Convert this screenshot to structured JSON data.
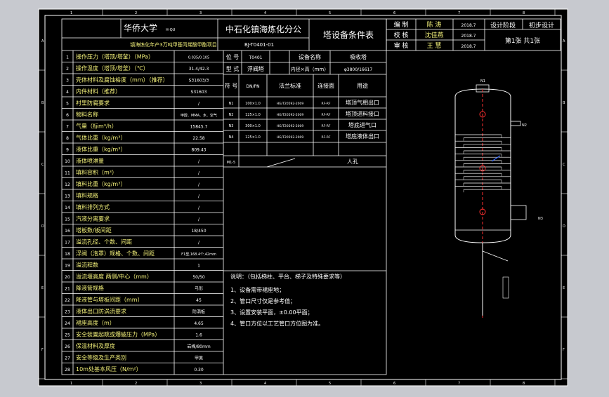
{
  "colors": {
    "background": "#c7c9cf",
    "sheet": "#000000",
    "line": "#ffffff",
    "text": "#ffffff",
    "highlight": "#f2f07a",
    "column_stroke": "#ffffff",
    "accent": "#ff3030",
    "marker": "#3a6cff",
    "arrow": "#00c8ff"
  },
  "header": {
    "university": "华侨大学",
    "university_suffix": "H-QU",
    "company": "中石化镇海炼化分公",
    "project": "镇海炼化年产3万吨甲基丙烯酸甲酯项目",
    "drawing_no": "BJ-T0401-01",
    "table_title": "塔设备条件表",
    "roles": [
      {
        "role": "编 制",
        "name": "陈 涛",
        "date": "2018.7"
      },
      {
        "role": "校 核",
        "name": "沈佳燕",
        "date": "2018.7"
      },
      {
        "role": "审 核",
        "name": "王 慧",
        "date": "2018.7"
      }
    ],
    "stage_label": "设计阶段",
    "stage_value": "初步设计",
    "sheet_info": "第1张 共1张"
  },
  "frame": {
    "left_letters": [
      "A",
      "B",
      "C",
      "D",
      "E",
      "F"
    ],
    "right_letters": [
      "A",
      "B",
      "C",
      "D",
      "E",
      "F"
    ],
    "top_numbers": [
      "1",
      "2",
      "3",
      "4",
      "5",
      "6",
      "7",
      "8"
    ],
    "bottom_numbers": [
      "1",
      "2",
      "3",
      "4",
      "5",
      "6",
      "7",
      "8"
    ]
  },
  "rows": [
    {
      "no": "1",
      "label": "操作压力（塔顶/塔釜）（MPa）",
      "value": "0.035/0.105"
    },
    {
      "no": "2",
      "label": "操作温度（塔顶/塔釜）（℃）",
      "value": "31.4/42.3"
    },
    {
      "no": "3",
      "label": "壳体材料及腐蚀裕度（mm）（推荐）",
      "value": "S31603/3"
    },
    {
      "no": "4",
      "label": "内件材料（推荐）",
      "value": "S31603"
    },
    {
      "no": "5",
      "label": "衬里防腐要求",
      "value": "/"
    },
    {
      "no": "6",
      "label": "物料名称",
      "value": "甲醇、MMA、水、空气"
    },
    {
      "no": "7",
      "label": "气量（标m³/h）",
      "value": "15845.7"
    },
    {
      "no": "8",
      "label": "气体比重（kg/m³）",
      "value": "22.58"
    },
    {
      "no": "9",
      "label": "液体比重（kg/m³）",
      "value": "809.43"
    },
    {
      "no": "10",
      "label": "液体喷淋量",
      "value": "/"
    },
    {
      "no": "11",
      "label": "填料容积（m³）",
      "value": "/"
    },
    {
      "no": "12",
      "label": "填料比重（kg/m³）",
      "value": "/"
    },
    {
      "no": "13",
      "label": "填料规格",
      "value": "/"
    },
    {
      "no": "14",
      "label": "填料排列方式",
      "value": "/"
    },
    {
      "no": "15",
      "label": "汽液分离要求",
      "value": "/"
    },
    {
      "no": "16",
      "label": "塔板数/板间距",
      "value": "18/450"
    },
    {
      "no": "17",
      "label": "溢流孔径、个数、间距",
      "value": "/"
    },
    {
      "no": "18",
      "label": "浮阀（泡罩）规格、个数、间距",
      "value": "F1型,168.4个,42mm"
    },
    {
      "no": "19",
      "label": "溢流程数",
      "value": "1"
    },
    {
      "no": "20",
      "label": "溢流堰高度 两侧/中心（mm）",
      "value": "50/50"
    },
    {
      "no": "21",
      "label": "降液管规格",
      "value": "弓形"
    },
    {
      "no": "22",
      "label": "降液管与塔板间距（mm）",
      "value": "45"
    },
    {
      "no": "23",
      "label": "液体出口防涡流要求",
      "value": "防涡板"
    },
    {
      "no": "24",
      "label": "裙座高度（m）",
      "value": "4.65"
    },
    {
      "no": "25",
      "label": "安全装置起跳或爆破压力（MPa）",
      "value": "1.6"
    },
    {
      "no": "26",
      "label": "保温材料及厚度",
      "value": "岩棉/80mm"
    },
    {
      "no": "27",
      "label": "安全等级及生产类别",
      "value": "甲类"
    },
    {
      "no": "28",
      "label": "10m处基本风压（N/m²）",
      "value": "0.30"
    }
  ],
  "info_panel": {
    "equipment_no_label": "位 号",
    "equipment_no": "T0401",
    "equipment_name_label": "设备名称",
    "equipment_name": "吸收塔",
    "type_label": "型 式",
    "type_value": "浮阀塔",
    "diameter_label": "内径×高（mm）",
    "diameter_value": "φ3800/16617",
    "nozzle_headers": {
      "symbol": "符 号",
      "size": "DN/PN",
      "standard": "法兰标准",
      "face": "连接面",
      "purpose": "用途"
    },
    "nozzles": [
      {
        "symbol": "N1",
        "size": "100×1.0",
        "standard": "HG/T20592-2009",
        "face": "RF-RF",
        "purpose": "塔顶气相出口"
      },
      {
        "symbol": "N2",
        "size": "125×1.0",
        "standard": "HG/T20592-2009",
        "face": "RF-RF",
        "purpose": "塔顶进料接口"
      },
      {
        "symbol": "N3",
        "size": "300×1.0",
        "standard": "HG/T20592-2009",
        "face": "RF-RF",
        "purpose": "塔底进气口"
      },
      {
        "symbol": "N4",
        "size": "125×1.0",
        "standard": "HG/T20592-2009",
        "face": "RF-RF",
        "purpose": "塔底液体出口"
      },
      {
        "symbol": "M1-5",
        "size": "",
        "standard": "",
        "face": "",
        "purpose": "人孔"
      }
    ],
    "notes_title": "说明：（包括梯柱、平台、梯子及特殊要求等）",
    "notes": [
      "1、设备需带裙座地；",
      "2、管口尺寸仅是参考值；",
      "3、设置安装平面，±0.00平面；",
      "4、管口方位以工艺管口方位图为准。"
    ]
  },
  "drawing": {
    "labels": {
      "top_nozzle": "N1",
      "side_upper": "N2",
      "side_lower": "N3"
    },
    "tray_count": 18
  }
}
